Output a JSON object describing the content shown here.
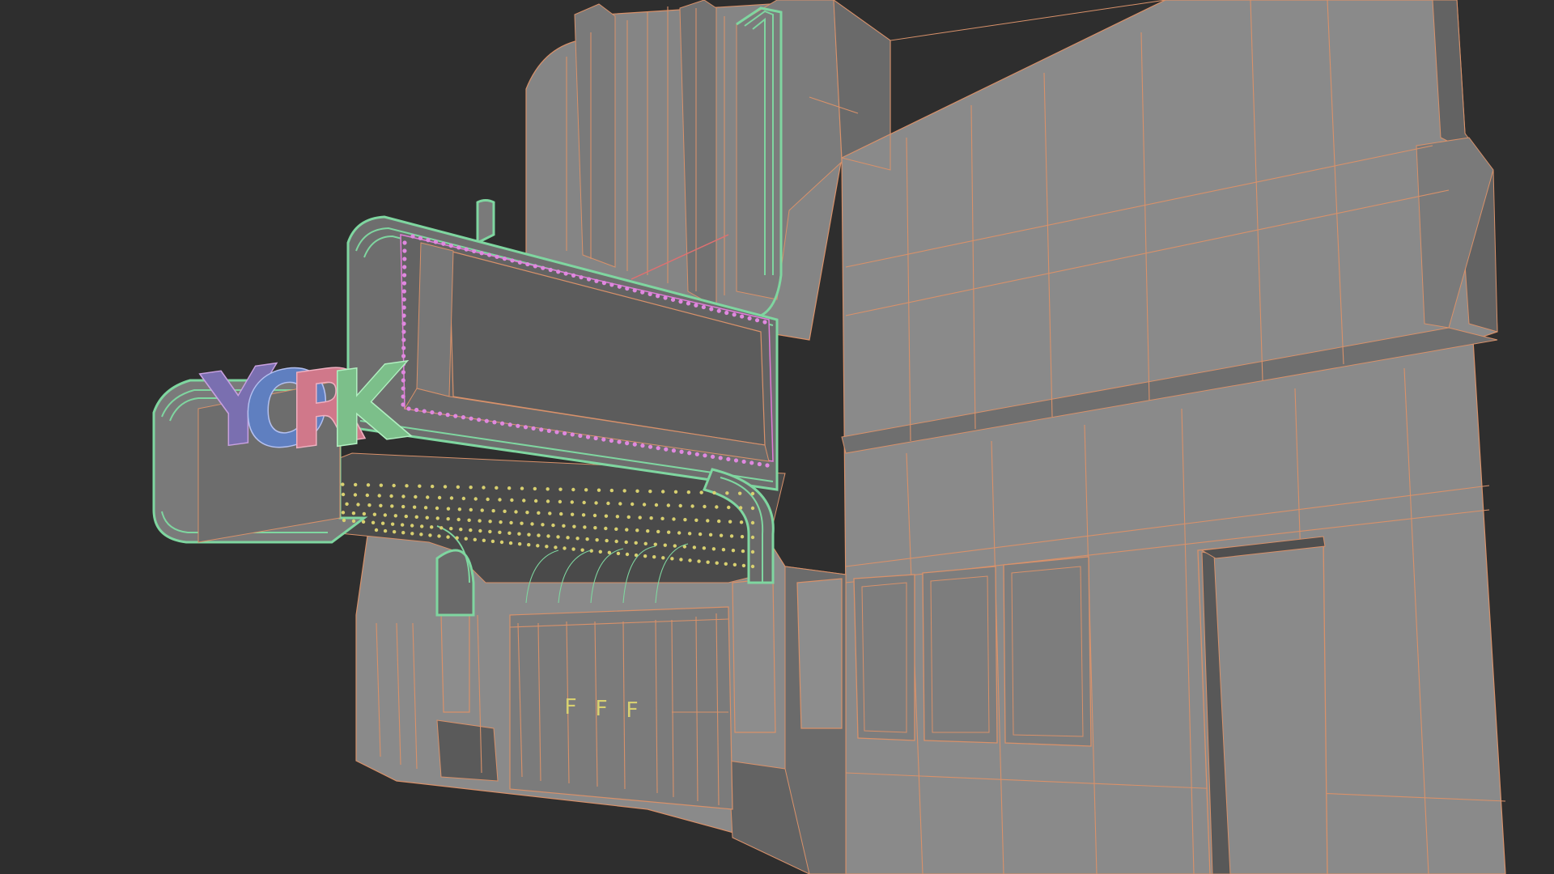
{
  "viewport": {
    "background": "#2e2e2e",
    "object": "theater-facade",
    "shading": "solid-gray-with-wireframe-overlay"
  },
  "marquee_sign": {
    "letters": [
      "Y",
      "O",
      "R",
      "K"
    ],
    "letter_colors": [
      "#7a6fb0",
      "#5f7fc0",
      "#d0788a",
      "#7cbf8a"
    ]
  },
  "door_glyphs": [
    "F",
    "F",
    "F"
  ],
  "colors": {
    "wire_orange": "#d8916a",
    "wire_green": "#7fd6a0",
    "wire_pink": "#e07ad8",
    "bulb_yellow": "#d8d070",
    "bulb_pink": "#e088e0",
    "face_light": "#8a8a8a",
    "face_mid": "#787878",
    "face_dark": "#5c5c5c",
    "face_shadow": "#4a4a4a"
  }
}
